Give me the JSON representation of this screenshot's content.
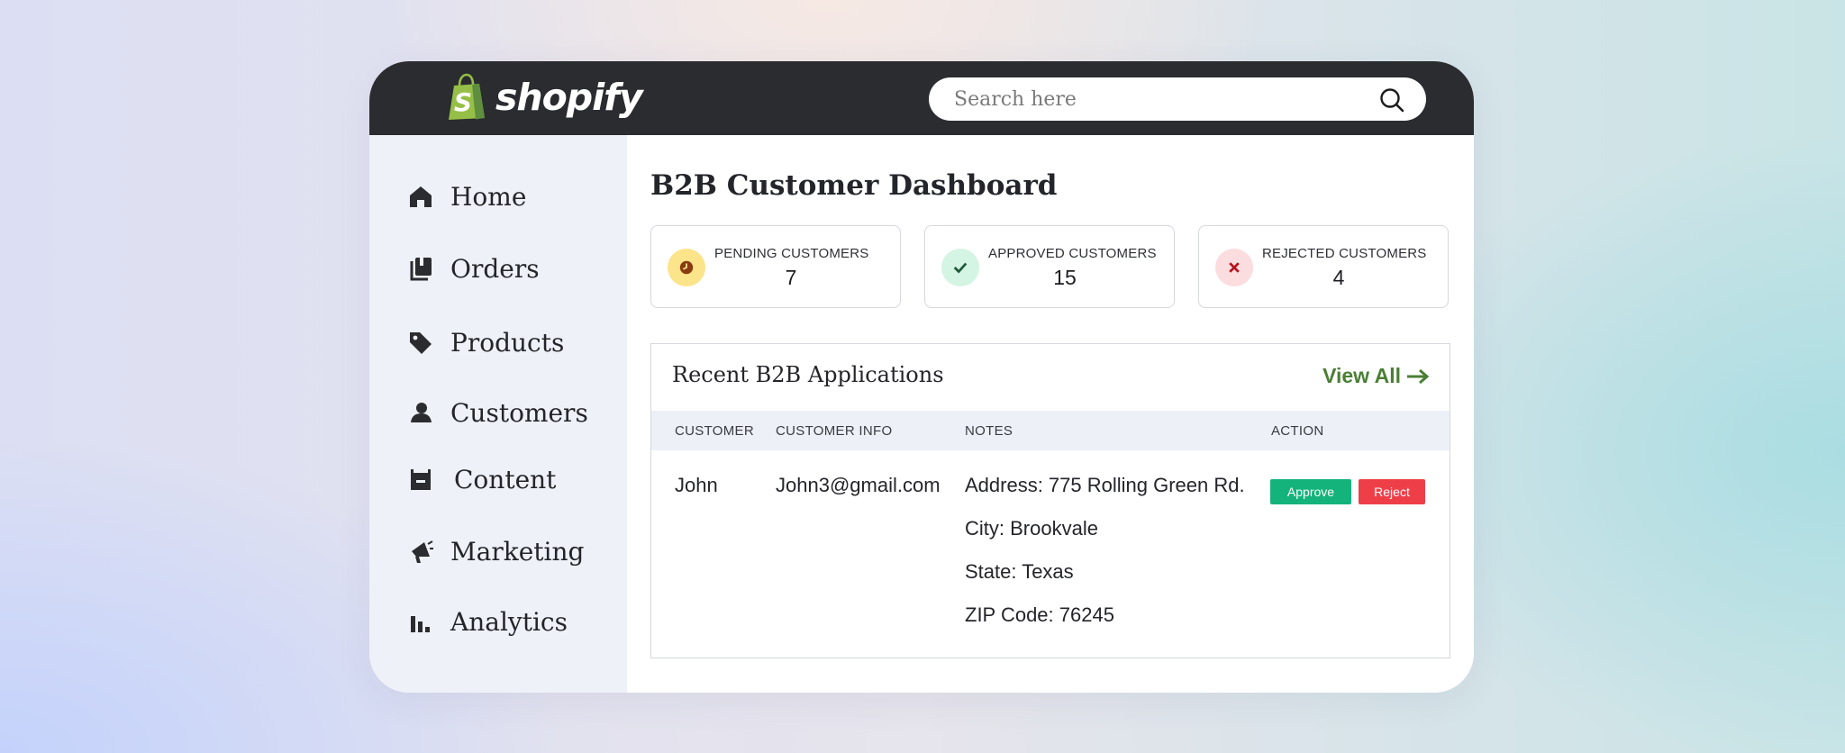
{
  "brand": {
    "name": "shopify",
    "logo_color": "#95bf47"
  },
  "search": {
    "placeholder": "Search here",
    "value": ""
  },
  "sidebar": {
    "items": [
      {
        "label": "Home",
        "icon": "home-icon"
      },
      {
        "label": "Orders",
        "icon": "orders-icon"
      },
      {
        "label": "Products",
        "icon": "tag-icon"
      },
      {
        "label": "Customers",
        "icon": "customer-icon"
      },
      {
        "label": "Content",
        "icon": "content-icon"
      },
      {
        "label": "Marketing",
        "icon": "megaphone-icon"
      },
      {
        "label": "Analytics",
        "icon": "bar-chart-icon"
      }
    ]
  },
  "dashboard": {
    "title": "B2B Customer Dashboard",
    "stats": [
      {
        "label": "PENDING CUSTOMERS",
        "value": "7",
        "icon": "clock-icon",
        "badge_color": "#fbe48a",
        "icon_color": "#8a3b12"
      },
      {
        "label": "APPROVED CUSTOMERS",
        "value": "15",
        "icon": "check-icon",
        "badge_color": "#d4f4e4",
        "icon_color": "#1f5a3a"
      },
      {
        "label": "REJECTED CUSTOMERS",
        "value": "4",
        "icon": "x-icon",
        "badge_color": "#fbdde0",
        "icon_color": "#b4141e"
      }
    ]
  },
  "recent": {
    "title": "Recent B2B Applications",
    "view_all": "View All",
    "view_all_color": "#4a7f34",
    "columns": [
      "CUSTOMER",
      "CUSTOMER INFO",
      "NOTES",
      "ACTION"
    ],
    "rows": [
      {
        "customer": "John",
        "info": "John3@gmail.com",
        "notes": [
          "Address: 775 Rolling Green Rd.",
          "City: Brookvale",
          "State: Texas",
          "ZIP Code: 76245"
        ],
        "approve": "Approve",
        "reject": "Reject"
      }
    ]
  }
}
